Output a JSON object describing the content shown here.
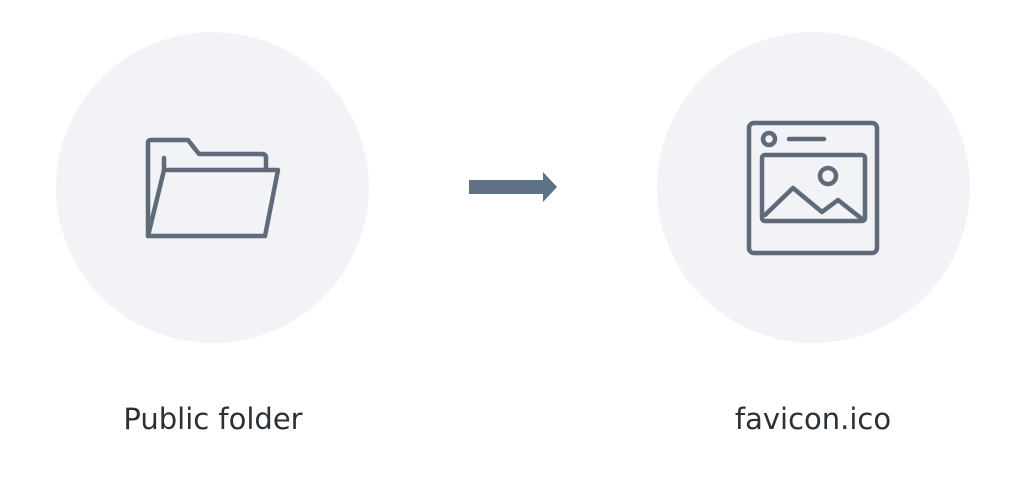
{
  "nodes": [
    {
      "label": "Public folder",
      "icon": "folder-icon"
    },
    {
      "label": "favicon.ico",
      "icon": "browser-image-icon"
    }
  ],
  "connector": {
    "icon": "arrow-right-icon"
  },
  "colors": {
    "icon_stroke": "#5f6b78",
    "circle_fill": "#f1f3f6",
    "arrow": "#5f7185",
    "text": "#2b2f36"
  }
}
